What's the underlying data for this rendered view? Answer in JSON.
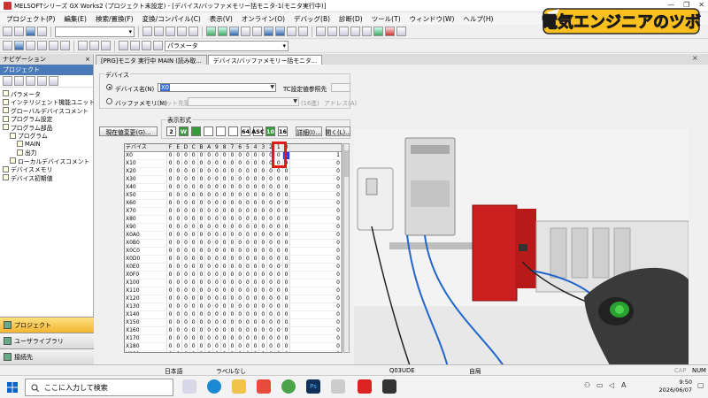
{
  "window": {
    "title": "MELSOFTシリーズ GX Works2 (プロジェクト未設定) - [デバイス/バッファメモリー括モニタ-1(モニタ実行中)]",
    "min": "—",
    "max": "❐",
    "close": "✕"
  },
  "menu": [
    "プロジェクト(P)",
    "編集(E)",
    "検索/置換(F)",
    "変換/コンパイル(C)",
    "表示(V)",
    "オンライン(O)",
    "デバッグ(B)",
    "診断(D)",
    "ツール(T)",
    "ウィンドウ(W)",
    "ヘルプ(H)"
  ],
  "toolbar": {
    "param_select": "パラメータ"
  },
  "banner": {
    "text": "電気エンジニアのツボ"
  },
  "navigation": {
    "title": "ナビゲーション",
    "pin": "×",
    "section": "プロジェクト",
    "tree": [
      {
        "label": "パラメータ",
        "indent": 0
      },
      {
        "label": "インテリジェント機能ユニット",
        "indent": 0
      },
      {
        "label": "グローバルデバイスコメント",
        "indent": 0
      },
      {
        "label": "プログラム設定",
        "indent": 0
      },
      {
        "label": "プログラム部品",
        "indent": 0
      },
      {
        "label": "プログラム",
        "indent": 1
      },
      {
        "label": "MAIN",
        "indent": 2
      },
      {
        "label": "出力",
        "indent": 2
      },
      {
        "label": "ローカルデバイスコメント",
        "indent": 1
      },
      {
        "label": "デバイスメモリ",
        "indent": 0
      },
      {
        "label": "デバイス初期値",
        "indent": 0
      }
    ],
    "bottom": [
      "プロジェクト",
      "ユーザライブラリ",
      "接続先"
    ]
  },
  "tabs": [
    {
      "label": "[PRG]モニタ 実行中 MAIN (読み取...",
      "active": false
    },
    {
      "label": "デバイス/バッファメモリー括モニタ...",
      "active": true
    }
  ],
  "tab_close": "×",
  "device_group": {
    "title": "デバイス",
    "device_label": "デバイス名(N)",
    "device_value": "X0",
    "tc_label": "TC設定値参照先",
    "browse": "参照(B)...",
    "buffer_label": "バッファメモリ(M)",
    "unit_label": "ユニット先頭(U)",
    "unit_hint": "(16進)",
    "addr_label": "アドレス(A)",
    "addr_unit": "10進"
  },
  "format": {
    "title": "表示形式",
    "buttons": [
      "2",
      "W",
      "",
      "",
      "",
      "",
      "64",
      "ASC",
      "10",
      "16"
    ],
    "detail": "詳細(I)...",
    "open": "開く(L)...",
    "save": "保存(E)..."
  },
  "current_value_btn": "現在値変更(G)...",
  "table": {
    "headers": [
      "デバイス",
      "F",
      "E",
      "D",
      "C",
      "B",
      "A",
      "9",
      "8",
      "7",
      "6",
      "5",
      "4",
      "3",
      "2",
      "1",
      "0",
      ""
    ],
    "rows": [
      "X0",
      "X10",
      "X20",
      "X30",
      "X40",
      "X50",
      "X60",
      "X70",
      "X80",
      "X90",
      "X0A0",
      "X0B0",
      "X0C0",
      "X0D0",
      "X0E0",
      "X0F0",
      "X100",
      "X110",
      "X120",
      "X130",
      "X140",
      "X150",
      "X160",
      "X170",
      "X180",
      "X190"
    ],
    "bit_value": "0",
    "word_value": "0",
    "x0_bit0": "1",
    "x0_value": "1"
  },
  "status": {
    "lang": "日本語",
    "label": "ラベルなし",
    "cpu": "Q03UDE",
    "station": "自局",
    "cap": "CAP",
    "num": "NUM"
  },
  "taskbar": {
    "search_placeholder": "ここに入力して検索",
    "time": "9:50",
    "date": "2026/06/07",
    "ime": "A"
  }
}
